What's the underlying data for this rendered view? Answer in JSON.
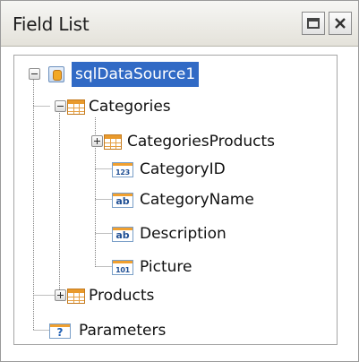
{
  "panel": {
    "title": "Field List",
    "restore_icon": "restore-window-icon",
    "close_icon": "close-icon"
  },
  "tree": {
    "datasource": {
      "label": "sqlDataSource1",
      "icon": "datasource-icon",
      "expanded": true,
      "selected": true
    },
    "categories": {
      "label": "Categories",
      "icon": "table-icon",
      "expanded": true
    },
    "categories_products": {
      "label": "CategoriesProducts",
      "icon": "table-icon",
      "expanded": false
    },
    "fields": [
      {
        "label": "CategoryID",
        "type_glyph": "123",
        "icon": "number-field-icon"
      },
      {
        "label": "CategoryName",
        "type_glyph": "ab",
        "icon": "text-field-icon"
      },
      {
        "label": "Description",
        "type_glyph": "ab",
        "icon": "text-field-icon"
      },
      {
        "label": "Picture",
        "type_glyph": "101",
        "icon": "binary-field-icon"
      }
    ],
    "products": {
      "label": "Products",
      "icon": "table-icon",
      "expanded": false
    },
    "parameters": {
      "label": "Parameters",
      "type_glyph": "?",
      "icon": "parameters-icon"
    }
  },
  "colors": {
    "selection": "#316ac5",
    "table_accent": "#e99a2c",
    "field_border": "#7a9fc8"
  }
}
